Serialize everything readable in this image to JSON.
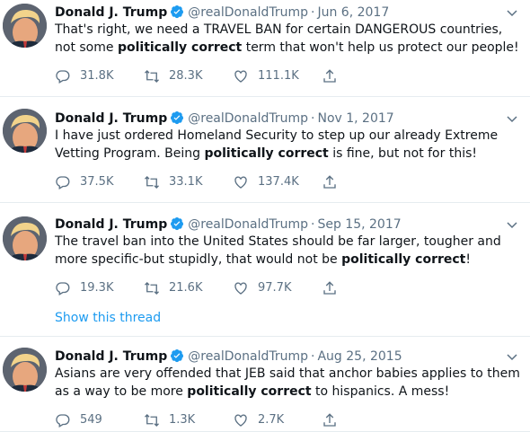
{
  "colors": {
    "accent": "#1d9bf0",
    "muted": "#5b7083",
    "text": "#0f1419",
    "divider": "#e6ecf0"
  },
  "icons": {
    "verified": "verified-badge-icon",
    "caret": "chevron-down-icon",
    "reply": "reply-icon",
    "retweet": "retweet-icon",
    "like": "heart-icon",
    "share": "share-icon"
  },
  "tweets": [
    {
      "name": "Donald J. Trump",
      "handle": "@realDonaldTrump",
      "separator": "·",
      "date": "Jun 6, 2017",
      "text_parts": [
        {
          "t": "That's right, we need a TRAVEL BAN for certain DANGEROUS countries, not some ",
          "bold": false
        },
        {
          "t": "politically correct",
          "bold": true
        },
        {
          "t": " term that won't help us protect our people!",
          "bold": false
        }
      ],
      "replies": "31.8K",
      "retweets": "28.3K",
      "likes": "111.1K"
    },
    {
      "name": "Donald J. Trump",
      "handle": "@realDonaldTrump",
      "separator": "·",
      "date": "Nov 1, 2017",
      "text_parts": [
        {
          "t": "I have just ordered Homeland Security to step up our already Extreme Vetting Program. Being ",
          "bold": false
        },
        {
          "t": "politically correct",
          "bold": true
        },
        {
          "t": " is fine, but not for this!",
          "bold": false
        }
      ],
      "replies": "37.5K",
      "retweets": "33.1K",
      "likes": "137.4K"
    },
    {
      "name": "Donald J. Trump",
      "handle": "@realDonaldTrump",
      "separator": "·",
      "date": "Sep 15, 2017",
      "text_parts": [
        {
          "t": "The travel ban into the United States should be far larger, tougher and more specific-but stupidly, that would not be ",
          "bold": false
        },
        {
          "t": "politically correct",
          "bold": true
        },
        {
          "t": "!",
          "bold": false
        }
      ],
      "replies": "19.3K",
      "retweets": "21.6K",
      "likes": "97.7K",
      "show_thread": "Show this thread"
    },
    {
      "name": "Donald J. Trump",
      "handle": "@realDonaldTrump",
      "separator": "·",
      "date": "Aug 25, 2015",
      "text_parts": [
        {
          "t": "Asians are very offended that JEB said that anchor babies applies to them as a way to be more ",
          "bold": false
        },
        {
          "t": "politically correct",
          "bold": true
        },
        {
          "t": " to hispanics. A mess!",
          "bold": false
        }
      ],
      "replies": "549",
      "retweets": "1.3K",
      "likes": "2.7K"
    }
  ]
}
